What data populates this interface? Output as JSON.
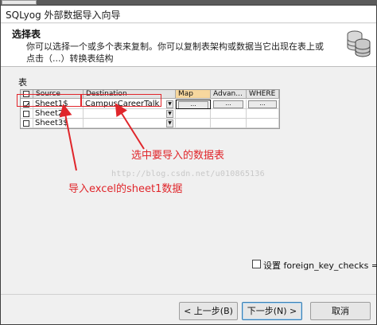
{
  "window": {
    "title": "SQLyog 外部数据导入向导"
  },
  "header": {
    "title": "选择表",
    "description": "你可以选择一个或多个表来复制。你可以复制表架构或数据当它出现在表上或点击（...）转换表结构"
  },
  "table_section_label": "表",
  "grid": {
    "columns": [
      "Source",
      "Destination",
      "Map",
      "Advan...",
      "WHERE"
    ],
    "rows": [
      {
        "checked": true,
        "source": "Sheet1$",
        "destination": "CampusCareerTalk",
        "map": "...",
        "advanced": "...",
        "where": "..."
      },
      {
        "checked": false,
        "source": "Sheet2$",
        "destination": ""
      },
      {
        "checked": false,
        "source": "Sheet3$",
        "destination": ""
      }
    ]
  },
  "annotations": {
    "select_table": "选中要导入的数据表",
    "import_excel": "导入excel的sheet1数据",
    "watermark": "http://blog.csdn.net/u010865136"
  },
  "foreign_key_checks": {
    "checked": false,
    "label": "设置 foreign_key_checks ="
  },
  "buttons": {
    "back": "< 上一步(B)",
    "next": "下一步(N) >",
    "cancel": "取消"
  },
  "colors": {
    "annotation_red": "#e0262b",
    "selected_header": "#f7d79e"
  }
}
